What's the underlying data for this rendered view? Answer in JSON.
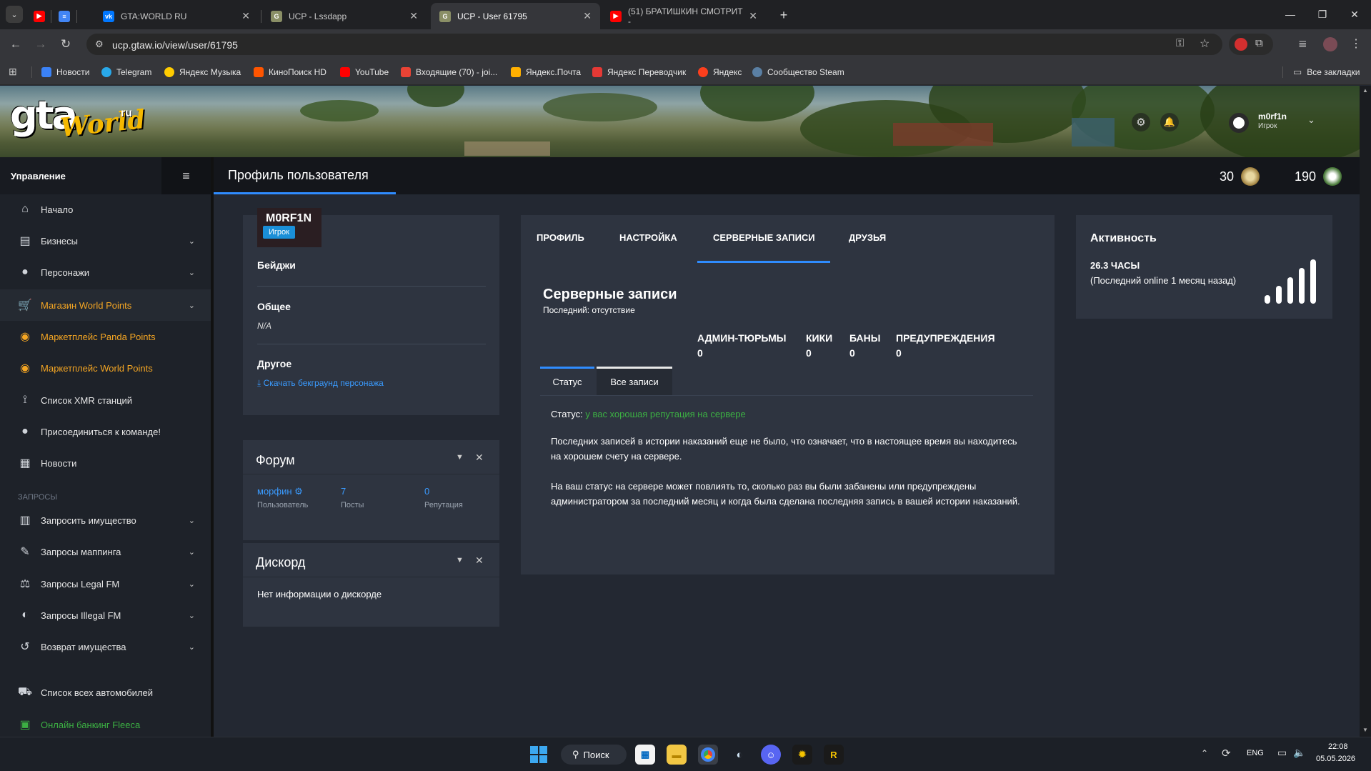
{
  "browser": {
    "tabs": [
      {
        "title": "",
        "icon": "youtube-icon",
        "color": "#ff0000"
      },
      {
        "title": "",
        "icon": "docs-icon",
        "color": "#4285f4"
      },
      {
        "title": "GTA:WORLD RU",
        "icon": "vk-icon",
        "color": "#0077ff"
      },
      {
        "title": "UCP - Lssdapp",
        "icon": "gtaw-icon",
        "color": "#8a8f66"
      },
      {
        "title": "UCP - User 61795",
        "icon": "gtaw-icon",
        "color": "#8a8f66"
      },
      {
        "title": "(51) БРАТИШКИН СМОТРИТ -",
        "icon": "youtube-icon",
        "color": "#ff0000"
      }
    ],
    "url": "ucp.gtaw.io/view/user/61795",
    "bookmarks": [
      {
        "label": "Новости",
        "color": "#3b82f6"
      },
      {
        "label": "Telegram",
        "color": "#29a9ea"
      },
      {
        "label": "Яндекс Музыка",
        "color": "#ffcc00"
      },
      {
        "label": "КиноПоиск HD",
        "color": "#ff5500"
      },
      {
        "label": "YouTube",
        "color": "#ff0000"
      },
      {
        "label": "Входящие (70) - joi...",
        "color": "#ea4335"
      },
      {
        "label": "Яндекс.Почта",
        "color": "#ffb000"
      },
      {
        "label": "Яндекс Переводчик",
        "color": "#e53935"
      },
      {
        "label": "Яндекс",
        "color": "#fc3f1d"
      },
      {
        "label": "Сообщество Steam",
        "color": "#1b2838"
      }
    ],
    "all_bookmarks": "Все закладки"
  },
  "header": {
    "logo_main": "gta",
    "logo_world": "World",
    "logo_ru": "ru",
    "username": "m0rf1n",
    "role": "Игрок"
  },
  "sidebar": {
    "title": "Управление",
    "items": [
      {
        "label": "Начало",
        "icon": "home-icon"
      },
      {
        "label": "Бизнесы",
        "icon": "briefcase-icon"
      },
      {
        "label": "Персонажи",
        "icon": "user-icon"
      },
      {
        "label": "Магазин World Points",
        "icon": "cart-icon"
      },
      {
        "label": "Маркетплейс Panda Points",
        "icon": "coins-icon"
      },
      {
        "label": "Маркетплейс World Points",
        "icon": "coins-icon"
      },
      {
        "label": "Список XMR станций",
        "icon": "antenna-icon"
      },
      {
        "label": "Присоединиться к команде!",
        "icon": "user-plus-icon"
      },
      {
        "label": "Новости",
        "icon": "newspaper-icon"
      }
    ],
    "group_label": "ЗАПРОСЫ",
    "requests": [
      {
        "label": "Запросить имущество",
        "icon": "building-icon"
      },
      {
        "label": "Запросы маппинга",
        "icon": "brush-icon"
      },
      {
        "label": "Запросы Legal FM",
        "icon": "scale-icon"
      },
      {
        "label": "Запросы Illegal FM",
        "icon": "mask-icon"
      },
      {
        "label": "Возврат имущества",
        "icon": "undo-icon"
      }
    ],
    "cars": "Список всех автомобилей",
    "banking": "Онлайн банкинг Fleeca"
  },
  "main": {
    "page_title": "Профиль пользователя",
    "panda_points": "30",
    "world_points": "190"
  },
  "profile": {
    "name": "M0RF1N",
    "role": "Игрок",
    "badges": "Бейджи",
    "general": "Общее",
    "general_value": "N/A",
    "other": "Другое",
    "download": "Скачать бекграунд персонажа"
  },
  "forum": {
    "title": "Форум",
    "user": "морфин",
    "user_label": "Пользователь",
    "posts": "7",
    "posts_label": "Посты",
    "rep": "0",
    "rep_label": "Репутация"
  },
  "discord": {
    "title": "Дискорд",
    "text": "Нет информации о дискорде"
  },
  "tabs": [
    "ПРОФИЛЬ",
    "НАСТРОЙКА",
    "СЕРВЕРНЫЕ ЗАПИСИ",
    "ДРУЗЬЯ"
  ],
  "records": {
    "title": "Серверные записи",
    "last": "Последний: отсутствие",
    "stats": [
      {
        "label": "АДМИН-ТЮРЬМЫ",
        "value": "0"
      },
      {
        "label": "КИКИ",
        "value": "0"
      },
      {
        "label": "БАНЫ",
        "value": "0"
      },
      {
        "label": "ПРЕДУПРЕЖДЕНИЯ",
        "value": "0"
      }
    ],
    "subtabs": [
      "Статус",
      "Все записи"
    ],
    "status_label": "Статус:",
    "status_value": "у вас хорошая репутация на сервере",
    "p1": "Последних записей в истории наказаний еще не было, что означает, что в настоящее время вы находитесь на хорошем счету на сервере.",
    "p2": "На ваш статус на сервере может повлиять то, сколько раз вы были забанены или предупреждены администратором за последний месяц и когда была сделана последняя запись в вашей истории наказаний."
  },
  "activity": {
    "title": "Активность",
    "hours": "26.3 ЧАСЫ",
    "last_online": "(Последний online 1 месяц назад)"
  },
  "taskbar": {
    "search": "Поиск",
    "lang": "ENG",
    "time": "22:08",
    "date": "05.05.2026"
  },
  "colors": {
    "accent": "#2f8cff",
    "orange": "#f5a623",
    "green_status": "#3cb043",
    "role_badge": "#1a8fd8"
  }
}
